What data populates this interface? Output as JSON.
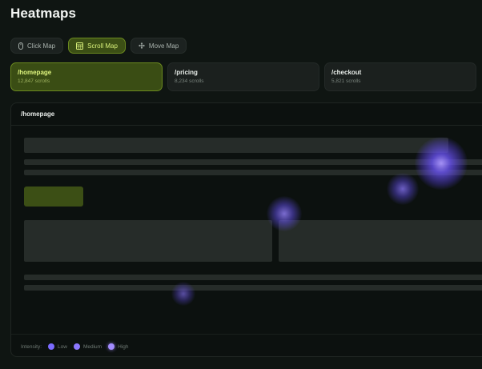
{
  "title": "Heatmaps",
  "tabs": [
    {
      "label": "Click Map",
      "icon": "mouse-icon",
      "active": false
    },
    {
      "label": "Scroll Map",
      "icon": "calendar-grid-icon",
      "active": true
    },
    {
      "label": "Move Map",
      "icon": "move-arrows-icon",
      "active": false
    }
  ],
  "pages": [
    {
      "path": "/homepage",
      "count": "12,847 scrolls",
      "active": true
    },
    {
      "path": "/pricing",
      "count": "8,234 scrolls",
      "active": false
    },
    {
      "path": "/checkout",
      "count": "5,821 scrolls",
      "active": false
    }
  ],
  "panel": {
    "title": "/homepage",
    "legend_label": "Intensity:",
    "legend": [
      {
        "label": "Low",
        "color": "#7b6bff"
      },
      {
        "label": "Medium",
        "color": "#8c78ff"
      },
      {
        "label": "High",
        "color": "#a38cff"
      }
    ]
  },
  "colors": {
    "accent": "#d8f07a",
    "accent_bg": "#3c4f15",
    "heat": "#6a55ff"
  }
}
